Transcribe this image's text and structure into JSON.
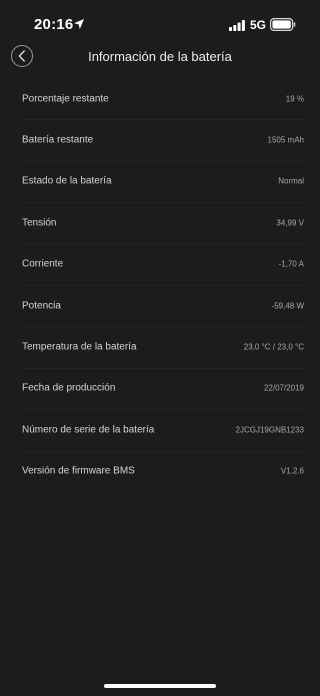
{
  "status_bar": {
    "time": "20:16",
    "network": "5G",
    "location_icon": "location-arrow-icon",
    "signal_icon": "cellular-signal-icon",
    "battery_icon": "battery-icon"
  },
  "header": {
    "title": "Información de la batería",
    "back_icon": "chevron-left-icon"
  },
  "rows": [
    {
      "label": "Porcentaje restante",
      "value": "19 %"
    },
    {
      "label": "Batería restante",
      "value": "1505 mAh"
    },
    {
      "label": "Estado de la batería",
      "value": "Normal"
    },
    {
      "label": "Tensión",
      "value": "34,99 V"
    },
    {
      "label": "Corriente",
      "value": "-1,70 A"
    },
    {
      "label": "Potencia",
      "value": "-59,48 W"
    },
    {
      "label": "Temperatura de la batería",
      "value": "23,0 °C / 23,0 °C"
    },
    {
      "label": "Fecha de producción",
      "value": "22/07/2019"
    },
    {
      "label": "Número de serie de la batería",
      "value": "2JCGJ19GNB1233"
    },
    {
      "label": "Versión de firmware BMS",
      "value": "V1.2.6"
    }
  ],
  "colors": {
    "background": "#1c1c1c",
    "text_primary": "#d4d4d4",
    "text_secondary": "#a8a8a8"
  }
}
